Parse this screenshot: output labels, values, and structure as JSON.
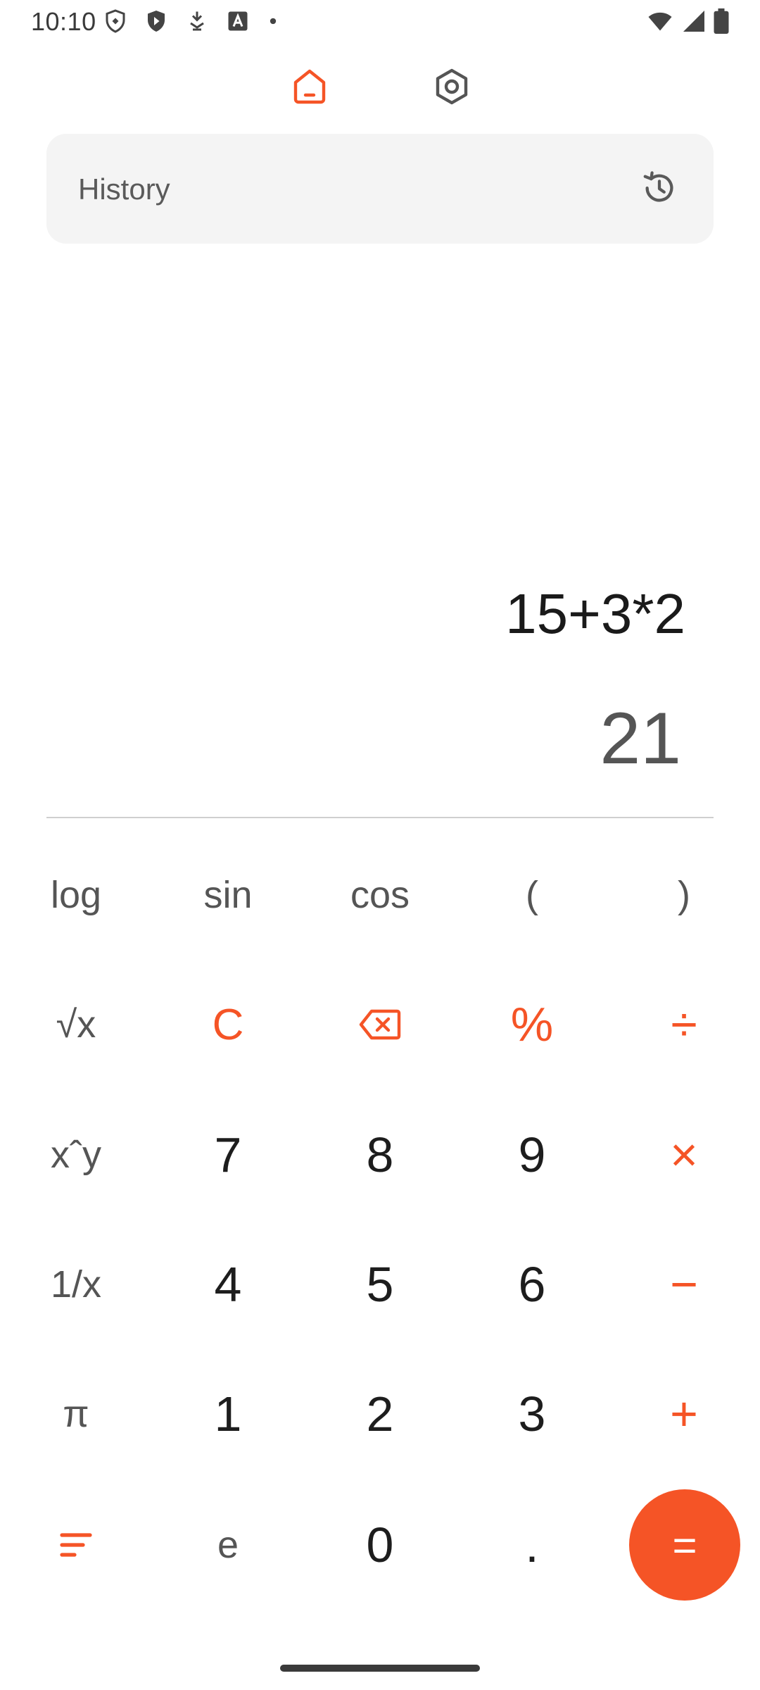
{
  "status_bar": {
    "time": "10:10",
    "icons_left": [
      "vpn-shield-icon",
      "shield-icon",
      "download-icon",
      "font-icon",
      "dot-icon"
    ],
    "icons_right": [
      "wifi-icon",
      "signal-icon",
      "battery-icon"
    ]
  },
  "nav": {
    "home_icon": "home-icon",
    "settings_icon": "hexagon-settings-icon",
    "accent": "#f55426"
  },
  "history": {
    "label": "History",
    "icon": "history-clock-icon"
  },
  "display": {
    "expression": "15+3*2",
    "result": "21"
  },
  "keypad": {
    "rows": [
      [
        "log",
        "sin",
        "cos",
        "(",
        ")"
      ],
      [
        "√x",
        "C",
        "backspace",
        "%",
        "÷"
      ],
      [
        "x^y",
        "7",
        "8",
        "9",
        "×"
      ],
      [
        "1/x",
        "4",
        "5",
        "6",
        "−"
      ],
      [
        "π",
        "1",
        "2",
        "3",
        "+"
      ],
      [
        "menu",
        "e",
        "0",
        ".",
        "="
      ]
    ],
    "labels": {
      "log": "log",
      "sin": "sin",
      "cos": "cos",
      "paren_open": "(",
      "paren_close": ")",
      "sqrt": "√x",
      "clear": "C",
      "percent": "%",
      "divide": "÷",
      "power": "xˆy",
      "seven": "7",
      "eight": "8",
      "nine": "9",
      "multiply": "×",
      "reciprocal": "1/x",
      "four": "4",
      "five": "5",
      "six": "6",
      "minus": "−",
      "pi": "π",
      "one": "1",
      "two": "2",
      "three": "3",
      "plus": "+",
      "e": "e",
      "zero": "0",
      "dot": ".",
      "equals": "="
    }
  },
  "colors": {
    "accent": "#f55426",
    "history_bg": "#f4f4f4",
    "divider": "#cfcfcf"
  }
}
